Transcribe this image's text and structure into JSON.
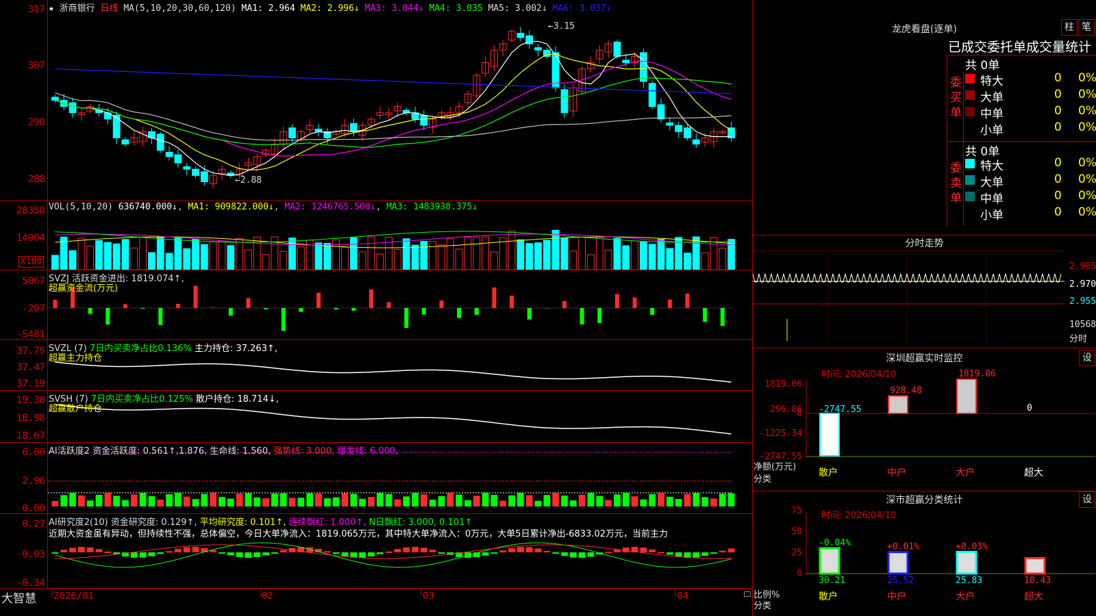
{
  "colors": {
    "up": "#ff2a2a",
    "down": "#00ffff",
    "grid": "#b00000",
    "ma1": "#ffffff",
    "ma2": "#ffff00",
    "ma3": "#ff00ff",
    "ma4": "#00ff00",
    "ma5": "#c0c0c0",
    "ma6": "#2020ff"
  },
  "main": {
    "star": "★",
    "stock_name": "浙商银行",
    "period": "日线",
    "ma_label": "MA(5,10,20,30,60,120)",
    "ma1": "MA1: 2.964",
    "ma2": "MA2: 2.996↓",
    "ma3": "MA3: 3.044↓",
    "ma4": "MA4: 3.035",
    "ma5": "MA5: 3.002↓",
    "ma6": "MA6: 3.037↓",
    "yticks": [
      "317",
      "307",
      "298",
      "288"
    ],
    "high_label": "3.15",
    "low_label": "2.88"
  },
  "vol": {
    "label": "VOL(5,10,20)",
    "value": "636740.000↓",
    "ma1": "MA1: 909822.000↓",
    "ma2": "MA2: 1246765.500↓",
    "ma3": "MA3: 1483938.375↓",
    "yticks": [
      "28358",
      "14004"
    ],
    "unit": "X100"
  },
  "svzj": {
    "label": "SVZJ  活跃资金进出: 1819.074↑,",
    "sub": "超赢资金流(万元)",
    "yticks": [
      "5067",
      "-207",
      "-5481"
    ]
  },
  "svzl": {
    "label": "SVZL (7)",
    "pct": "7日内买卖净占比0.136%",
    "hold": "主力持仓: 37.263↑,",
    "sub": "超赢主力持仓",
    "yticks": [
      "37.75",
      "37.47",
      "37.19"
    ]
  },
  "svsh": {
    "label": "SVSH (7)",
    "pct": "7日内买卖净占比0.125%",
    "hold": "散户持仓: 18.714↓,",
    "sub": "超赢散户持仓",
    "yticks": [
      "19.30",
      "18.98",
      "18.67"
    ]
  },
  "ai1": {
    "label": "AI活跃度2 资金活跃度: 0.561↑,1.876, 生命线: 1.560,",
    "strong": "强势线: 3.000,",
    "burst": "爆发线: 6.000,",
    "yticks": [
      "6.00",
      "2.96",
      "0.00"
    ]
  },
  "ai2": {
    "label": "AI研究度2(10) 资金研究度: 0.129↑,",
    "avg": "平均研究度: 0.101↑,",
    "cont": "连续飘红: 1.000↑,",
    "nday": "N日飘红: 3.000, 0.101↑",
    "comment": "近期大资金虽有异动，但持续性不强，总体偏空，今日大单净流入：1819.065万元，其中特大单净流入：0万元，大单5日累计净出-6833.02万元，当前主力",
    "yticks": [
      "0.27",
      "-0.03",
      "-0.34"
    ]
  },
  "xaxis": {
    "labels": [
      "2026/01",
      "02",
      "03",
      "04"
    ]
  },
  "brand": "大智慧",
  "lhb": {
    "title": "龙虎看盘(逐单)",
    "btn1": "柱",
    "btn2": "笔",
    "subtitle": "已成交委托单成交量统计",
    "buy_side": "委买单",
    "sell_side": "委卖单",
    "buy_total": "共 0单",
    "sell_total": "共 0单",
    "buy_rows": [
      {
        "label": "特大",
        "n": "0",
        "pct": "0%",
        "color": "#ff0000"
      },
      {
        "label": "大单",
        "n": "0",
        "pct": "0%",
        "color": "#a00000"
      },
      {
        "label": "中单",
        "n": "0",
        "pct": "0%",
        "color": "#700000"
      },
      {
        "label": "小单",
        "n": "0",
        "pct": "0%",
        "color": "#000000"
      }
    ],
    "sell_rows": [
      {
        "label": "特大",
        "n": "0",
        "pct": "0%",
        "color": "#00ffff"
      },
      {
        "label": "大单",
        "n": "0",
        "pct": "0%",
        "color": "#008c8c"
      },
      {
        "label": "中单",
        "n": "0",
        "pct": "0%",
        "color": "#006e6e"
      },
      {
        "label": "小单",
        "n": "0",
        "pct": "0%",
        "color": "#000000"
      }
    ]
  },
  "fenshi": {
    "title": "分时走势",
    "yticks": [
      "2.985",
      "2.970",
      "2.955"
    ],
    "vol": "10568",
    "label": "分时"
  },
  "sz_monitor": {
    "title": "深圳超赢实时监控",
    "btn": "设",
    "time": "时间: 2026/04/10",
    "yticks": [
      "1819.06",
      "296.86",
      "0",
      "-1225.34",
      "-2747.55"
    ],
    "bars": [
      {
        "cat": "散户",
        "value": -2747.55,
        "label": "-2747.55"
      },
      {
        "cat": "中户",
        "value": 928.48,
        "label": "928.48"
      },
      {
        "cat": "大户",
        "value": 1819.06,
        "label": "1819.06"
      },
      {
        "cat": "超大",
        "value": 0,
        "label": "0"
      }
    ],
    "ylabel": "净额(万元)",
    "xlabel": "分类"
  },
  "sz_class": {
    "title": "深市超赢分类统计",
    "btn": "设",
    "time": "时间: 2026/04/10",
    "yticks": [
      "75",
      "50",
      "25",
      "0"
    ],
    "bars": [
      {
        "cat": "散户",
        "value": 30.21,
        "change": "-0.04%",
        "color": "#00ff00"
      },
      {
        "cat": "中户",
        "value": 25.52,
        "change": "+0.01%",
        "color": "#2020ff"
      },
      {
        "cat": "大户",
        "value": 25.83,
        "change": "+0.03%",
        "color": "#00ffff"
      },
      {
        "cat": "超大",
        "value": 18.43,
        "change": "",
        "color": "#ff2a2a"
      }
    ],
    "values": [
      "30.21",
      "25.52",
      "25.83",
      "18.43"
    ],
    "ylabel": "比例%",
    "xlabel": "分类"
  },
  "chart_data": {
    "type": "candlestick",
    "title": "浙商银行 日线",
    "high": 3.15,
    "low": 2.88,
    "ylim": [
      2.86,
      3.18
    ],
    "close": [
      3.02,
      3.01,
      3.0,
      3.0,
      3.01,
      3.0,
      2.99,
      2.96,
      2.95,
      2.96,
      2.97,
      2.96,
      2.94,
      2.93,
      2.92,
      2.91,
      2.9,
      2.89,
      2.9,
      2.91,
      2.9,
      2.91,
      2.92,
      2.93,
      2.94,
      2.95,
      2.97,
      2.96,
      2.97,
      2.98,
      2.97,
      2.96,
      2.97,
      2.98,
      2.97,
      2.98,
      2.99,
      3.0,
      3.0,
      3.01,
      3.0,
      2.99,
      2.98,
      2.99,
      3.0,
      3.0,
      3.01,
      3.03,
      3.06,
      3.08,
      3.1,
      3.11,
      3.13,
      3.12,
      3.11,
      3.1,
      3.09,
      3.04,
      3.0,
      3.04,
      3.07,
      3.08,
      3.1,
      3.11,
      3.09,
      3.08,
      3.09,
      3.05,
      3.01,
      2.99,
      2.98,
      2.97,
      2.96,
      2.95,
      2.96,
      2.97,
      2.97,
      2.96
    ]
  }
}
